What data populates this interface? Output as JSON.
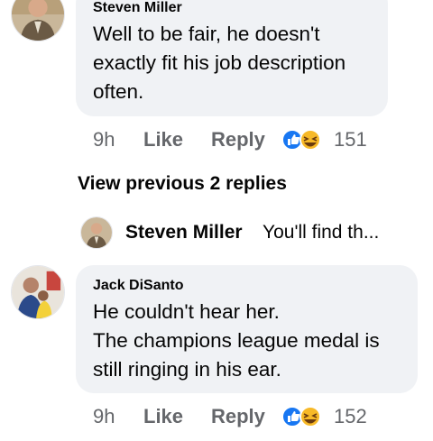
{
  "comment1": {
    "author": "Steven Miller",
    "lines": [
      "Well to be fair, he doesn't",
      "exactly fit his job description",
      "often."
    ],
    "time": "9h",
    "like_label": "Like",
    "reply_label": "Reply",
    "reaction_count": "151",
    "reactions": [
      "like-icon",
      "haha-icon"
    ]
  },
  "view_previous": "View previous 2 replies",
  "reply_preview": {
    "author": "Steven Miller",
    "snippet": "You'll find th...",
    "snippet_shown": "You'll find th..."
  },
  "comment2": {
    "author": "Jack DiSanto",
    "lines": [
      "He couldn't hear her.",
      "The champions league medal is",
      "still ringing in his ear."
    ],
    "time": "9h",
    "like_label": "Like",
    "reply_label": "Reply",
    "reaction_count": "152",
    "reactions": [
      "like-icon",
      "haha-icon"
    ]
  },
  "colors": {
    "bubble": "#f0f2f5",
    "meta": "#65676b",
    "like_blue": "#1877f2",
    "haha_yellow": "#f7b928"
  }
}
